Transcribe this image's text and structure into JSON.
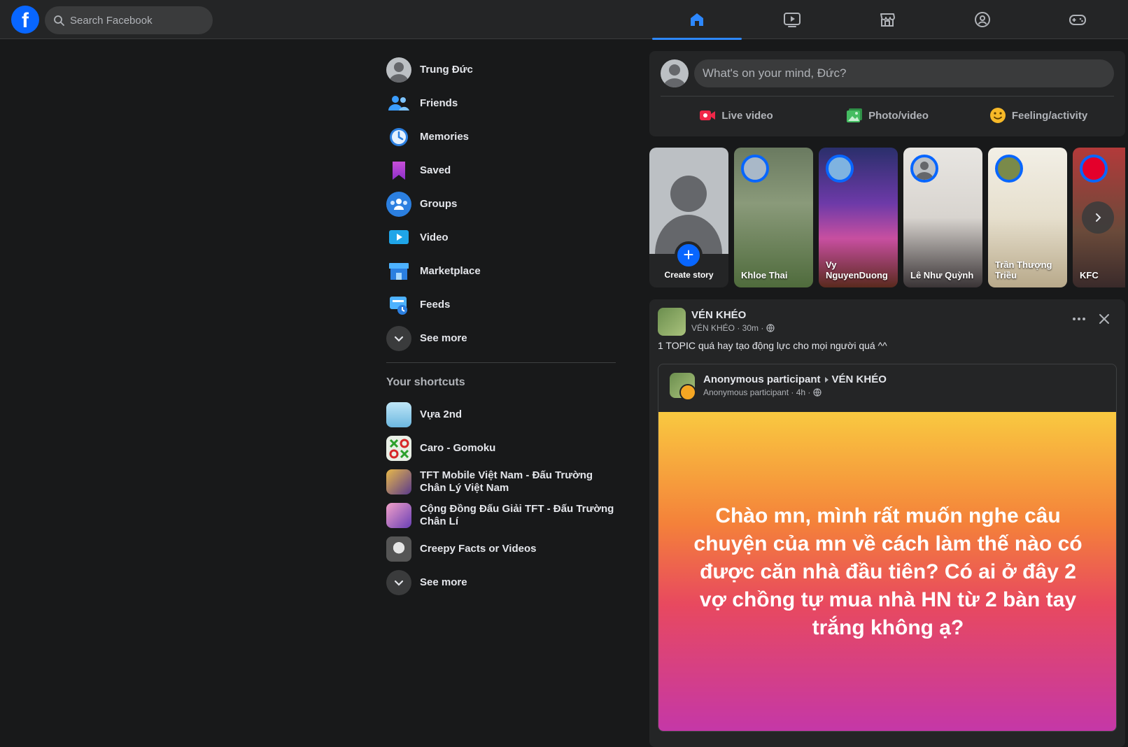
{
  "topbar": {
    "logo_letter": "f",
    "search_placeholder": "Search Facebook",
    "nav": [
      {
        "name": "home",
        "icon": "home-icon",
        "active": true
      },
      {
        "name": "video",
        "icon": "video-play-icon",
        "active": false
      },
      {
        "name": "marketplace",
        "icon": "store-icon",
        "active": false
      },
      {
        "name": "groups",
        "icon": "groups-icon",
        "active": false
      },
      {
        "name": "gaming",
        "icon": "gamepad-icon",
        "active": false
      }
    ],
    "accent_color": "#2d88ff"
  },
  "sidebar": {
    "items": [
      {
        "label": "Trung Đức",
        "icon": "profile-avatar"
      },
      {
        "label": "Friends",
        "icon": "friends-icon"
      },
      {
        "label": "Memories",
        "icon": "memories-clock-icon"
      },
      {
        "label": "Saved",
        "icon": "bookmark-icon"
      },
      {
        "label": "Groups",
        "icon": "groups-icon"
      },
      {
        "label": "Video",
        "icon": "video-icon"
      },
      {
        "label": "Marketplace",
        "icon": "marketplace-icon"
      },
      {
        "label": "Feeds",
        "icon": "feeds-icon"
      },
      {
        "label": "See more",
        "icon": "chevron-down-icon"
      }
    ],
    "shortcuts_title": "Your shortcuts",
    "shortcuts": [
      {
        "label": "Vựa 2nd"
      },
      {
        "label": "Caro - Gomoku"
      },
      {
        "label": "TFT Mobile Việt Nam - Đấu Trường Chân Lý Việt Nam"
      },
      {
        "label": "Cộng Đồng Đấu Giải TFT - Đấu Trường Chân Lí"
      },
      {
        "label": "Creepy Facts or Videos"
      },
      {
        "label": "See more"
      }
    ]
  },
  "composer": {
    "placeholder": "What's on your mind, Đức?",
    "actions": [
      {
        "label": "Live video",
        "icon": "live-video-icon",
        "color": "#f02849"
      },
      {
        "label": "Photo/video",
        "icon": "photo-icon",
        "color": "#45bd62"
      },
      {
        "label": "Feeling/activity",
        "icon": "smiley-icon",
        "color": "#f7b928"
      }
    ]
  },
  "stories": {
    "create_label": "Create story",
    "items": [
      {
        "name": "Khloe Thai"
      },
      {
        "name": "Vy NguyenDuong"
      },
      {
        "name": "Lê Như Quỳnh"
      },
      {
        "name": "Trần Thượng Triều"
      },
      {
        "name": "KFC"
      }
    ]
  },
  "post": {
    "author": "VÉN KHÉO",
    "meta": "VÉN KHÉO · 30m ·",
    "text": "1 TOPIC quá hay tạo động lực cho mọi người quá ^^",
    "shared": {
      "author": "Anonymous participant",
      "group": "VÉN KHÉO",
      "meta": "Anonymous participant · 4h ·",
      "body": "Chào mn, mình rất muốn nghe câu chuyện của mn về cách làm thế nào có được căn nhà đầu tiên? Có ai ở đây 2 vợ chồng tự mua nhà HN từ 2 bàn tay trắng không ạ?"
    }
  }
}
